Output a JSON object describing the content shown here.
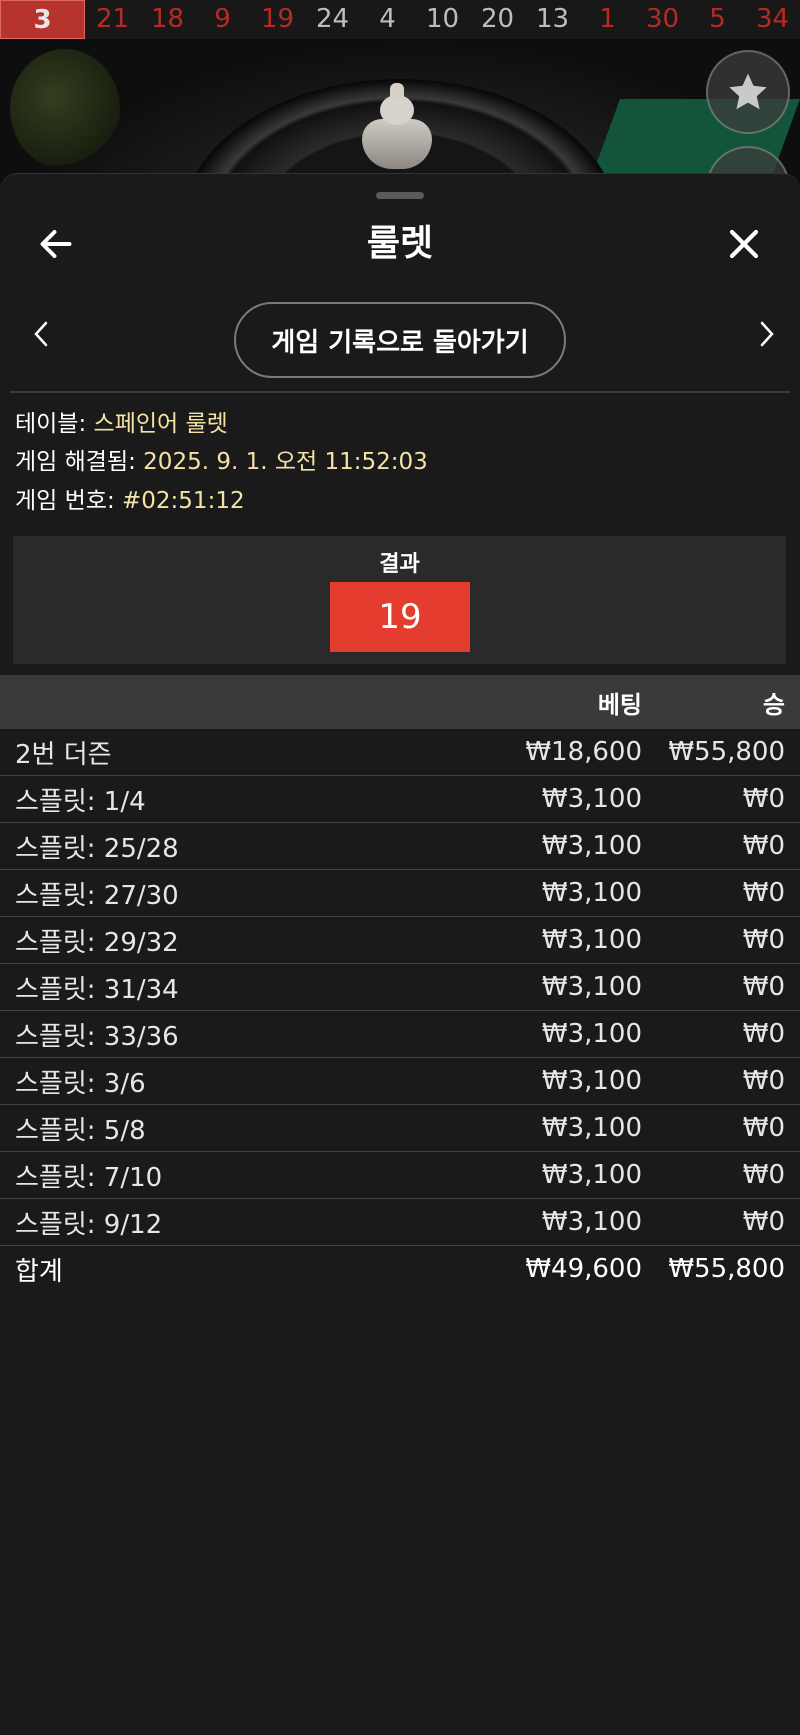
{
  "history": [
    {
      "n": "3",
      "color": "red",
      "current": true
    },
    {
      "n": "21",
      "color": "red"
    },
    {
      "n": "18",
      "color": "red"
    },
    {
      "n": "9",
      "color": "red"
    },
    {
      "n": "19",
      "color": "red"
    },
    {
      "n": "24",
      "color": "black"
    },
    {
      "n": "4",
      "color": "black"
    },
    {
      "n": "10",
      "color": "black"
    },
    {
      "n": "20",
      "color": "black"
    },
    {
      "n": "13",
      "color": "black"
    },
    {
      "n": "1",
      "color": "red"
    },
    {
      "n": "30",
      "color": "red"
    },
    {
      "n": "5",
      "color": "red"
    },
    {
      "n": "34",
      "color": "red"
    }
  ],
  "header": {
    "title": "룰렛"
  },
  "nav": {
    "back_to_history": "게임 기록으로 돌아가기"
  },
  "info": {
    "table_label": "테이블: ",
    "table_value": "스페인어 룰렛",
    "resolved_label": "게임 해결됨: ",
    "resolved_value": "2025. 9. 1. 오전 11:52:03",
    "game_no_label": "게임 번호: ",
    "game_no_value": "#02:51:12"
  },
  "result": {
    "title": "결과",
    "number": "19",
    "color": "#e43d30"
  },
  "table": {
    "col_bet": "베팅",
    "col_win": "승",
    "rows": [
      {
        "name": "2번 더즌",
        "bet": "₩18,600",
        "win": "₩55,800"
      },
      {
        "name": "스플릿: 1/4",
        "bet": "₩3,100",
        "win": "₩0"
      },
      {
        "name": "스플릿: 25/28",
        "bet": "₩3,100",
        "win": "₩0"
      },
      {
        "name": "스플릿: 27/30",
        "bet": "₩3,100",
        "win": "₩0"
      },
      {
        "name": "스플릿: 29/32",
        "bet": "₩3,100",
        "win": "₩0"
      },
      {
        "name": "스플릿: 31/34",
        "bet": "₩3,100",
        "win": "₩0"
      },
      {
        "name": "스플릿: 33/36",
        "bet": "₩3,100",
        "win": "₩0"
      },
      {
        "name": "스플릿: 3/6",
        "bet": "₩3,100",
        "win": "₩0"
      },
      {
        "name": "스플릿: 5/8",
        "bet": "₩3,100",
        "win": "₩0"
      },
      {
        "name": "스플릿: 7/10",
        "bet": "₩3,100",
        "win": "₩0"
      },
      {
        "name": "스플릿: 9/12",
        "bet": "₩3,100",
        "win": "₩0"
      }
    ],
    "total": {
      "name": "합계",
      "bet": "₩49,600",
      "win": "₩55,800"
    }
  }
}
